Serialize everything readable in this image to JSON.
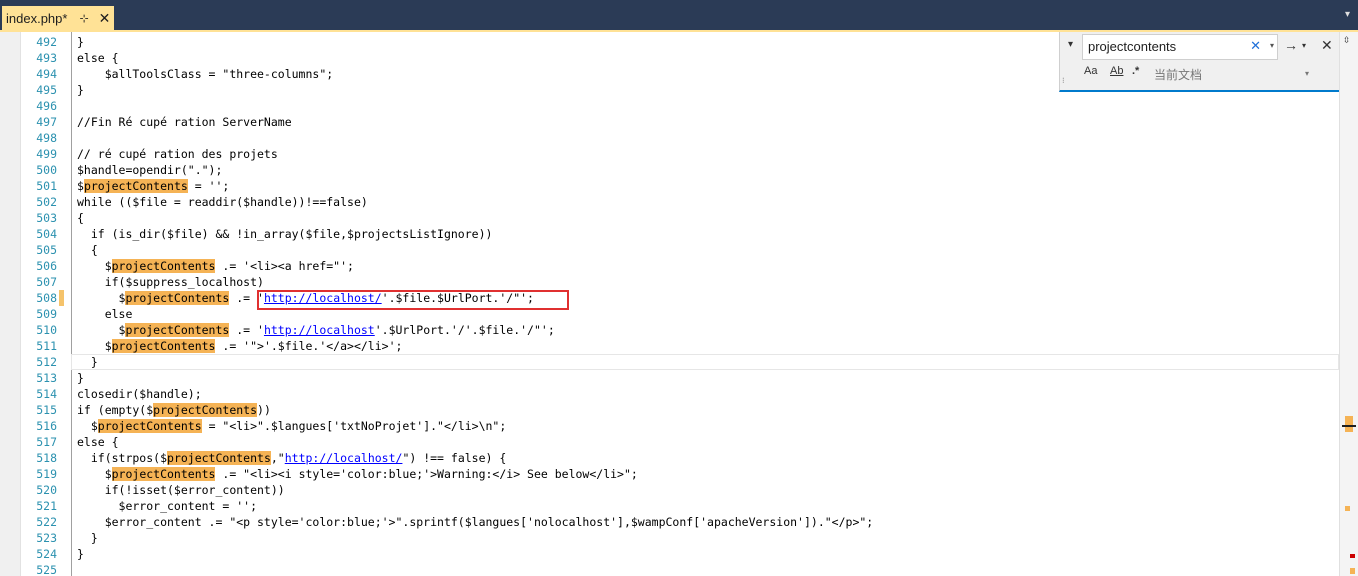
{
  "tab": {
    "name": "index.php*",
    "pin": "⊹",
    "close": "✕",
    "menu": "▾"
  },
  "find": {
    "query": "projectcontents",
    "clear": "✕",
    "history": "▾",
    "next": "→",
    "next_menu": "▾",
    "close": "✕",
    "expand": "▾",
    "match_case": "Aa",
    "whole_word": "Ab",
    "regex": ".*",
    "scope": "当前文档",
    "scope_dd": "▾"
  },
  "lines": [
    {
      "n": "492",
      "html": "}"
    },
    {
      "n": "493",
      "html": "else {"
    },
    {
      "n": "494",
      "html": "    $allToolsClass = \"three-columns\";"
    },
    {
      "n": "495",
      "html": "}"
    },
    {
      "n": "496",
      "html": ""
    },
    {
      "n": "497",
      "html": "//Fin Ré cupé ration ServerName"
    },
    {
      "n": "498",
      "html": ""
    },
    {
      "n": "499",
      "html": "// ré cupé ration des projets"
    },
    {
      "n": "500",
      "html": "$handle=opendir(\".\");"
    },
    {
      "n": "501",
      "html": "$<span class=\"hl\">projectContents</span> = '';"
    },
    {
      "n": "502",
      "html": "while (($file = readdir($handle))!==false)"
    },
    {
      "n": "503",
      "html": "{"
    },
    {
      "n": "504",
      "html": "  if (is_dir($file) &amp;&amp; !in_array($file,$projectsListIgnore))"
    },
    {
      "n": "505",
      "html": "  {"
    },
    {
      "n": "506",
      "html": "    $<span class=\"hl\">projectContents</span> .= '&lt;li&gt;&lt;a href=\"';"
    },
    {
      "n": "507",
      "html": "    if($suppress_localhost)"
    },
    {
      "n": "508",
      "html": "      $<span class=\"hl\">projectContents</span> .= '<span class=\"url\">http://localhost/</span>'.$file.$UrlPort.'/\"';"
    },
    {
      "n": "509",
      "html": "    else"
    },
    {
      "n": "510",
      "html": "      $<span class=\"hl\">projectContents</span> .= '<span class=\"url\">http://localhost</span>'.$UrlPort.'/'.$file.'/\"';"
    },
    {
      "n": "511",
      "html": "    $<span class=\"hl\">projectContents</span> .= '\"&gt;'.$file.'&lt;/a&gt;&lt;/li&gt;';"
    },
    {
      "n": "512",
      "html": "  }"
    },
    {
      "n": "513",
      "html": "}"
    },
    {
      "n": "514",
      "html": "closedir($handle);"
    },
    {
      "n": "515",
      "html": "if (empty($<span class=\"hl\">projectContents</span>))"
    },
    {
      "n": "516",
      "html": "  $<span class=\"hl\">projectContents</span> = \"&lt;li&gt;\".$langues['txtNoProjet'].\"&lt;/li&gt;\\n\";"
    },
    {
      "n": "517",
      "html": "else {"
    },
    {
      "n": "518",
      "html": "  if(strpos($<span class=\"hl\">projectContents</span>,\"<span class=\"url\">http://localhost/</span>\") !== false) {"
    },
    {
      "n": "519",
      "html": "    $<span class=\"hl\">projectContents</span> .= \"&lt;li&gt;&lt;i style='color:blue;'&gt;Warning:&lt;/i&gt; See below&lt;/li&gt;\";"
    },
    {
      "n": "520",
      "html": "    if(!isset($error_content))"
    },
    {
      "n": "521",
      "html": "      $error_content = '';"
    },
    {
      "n": "522",
      "html": "    $error_content .= \"&lt;p style='color:blue;'&gt;\".sprintf($langues['nolocalhost'],$wampConf['apacheVersion']).\"&lt;/p&gt;\";"
    },
    {
      "n": "523",
      "html": "  }"
    },
    {
      "n": "524",
      "html": "}"
    },
    {
      "n": "525",
      "html": ""
    }
  ],
  "colors": {
    "highlight": "#f5b355",
    "url": "#0000ff",
    "line_number": "#2b91af",
    "tab_active": "#ffe296",
    "tab_strip": "#2b3b56"
  }
}
